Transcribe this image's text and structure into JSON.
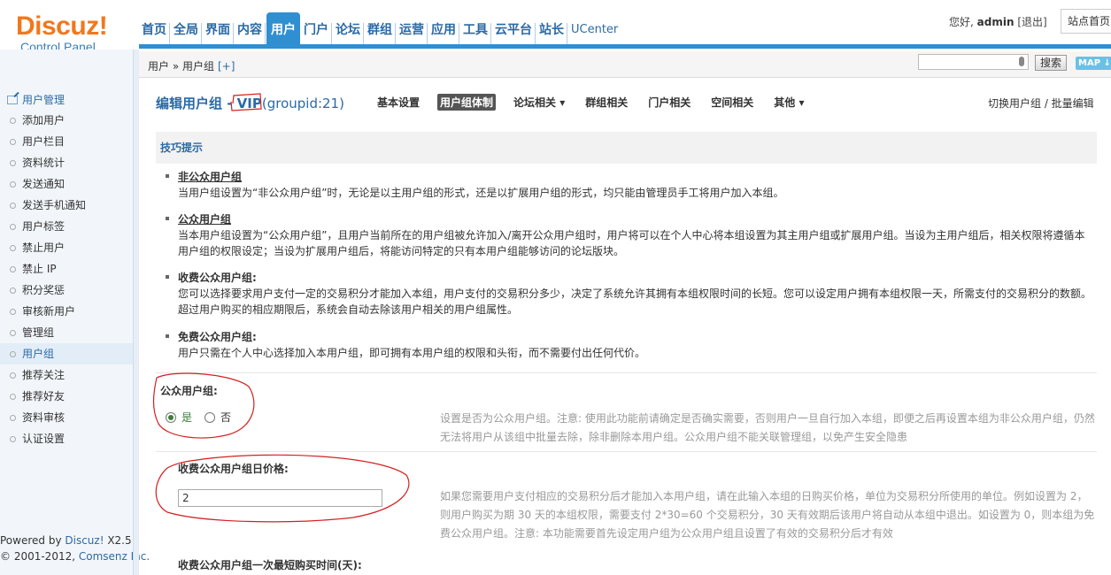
{
  "header": {
    "logo_main": "Discuz!",
    "logo_sub": "Control Panel",
    "nav": [
      "首页",
      "全局",
      "界面",
      "内容",
      "用户",
      "门户",
      "论坛",
      "群组",
      "运营",
      "应用",
      "工具",
      "云平台",
      "站长",
      "UCenter"
    ],
    "nav_active": "用户",
    "greeting": "您好,",
    "username": "admin",
    "logout": "[退出]",
    "site_home": "站点首页"
  },
  "subbar": {
    "breadcrumb": "用户 » 用户组",
    "add": "[+]",
    "search_placeholder": "",
    "search_button": "搜索",
    "map_button": "MAP ↓"
  },
  "sidebar": {
    "title": "用户管理",
    "items": [
      "添加用户",
      "用户栏目",
      "资料统计",
      "发送通知",
      "发送手机通知",
      "用户标签",
      "禁止用户",
      "禁止 IP",
      "积分奖惩",
      "审核新用户",
      "管理组",
      "用户组",
      "推荐关注",
      "推荐好友",
      "资料审核",
      "认证设置"
    ],
    "active": "用户组",
    "powered_prefix": "Powered by ",
    "powered_brand": "Discuz!",
    "powered_version": " X2.5",
    "copyright_prefix": "© 2001-2012, ",
    "copyright_brand": "Comsenz Inc."
  },
  "main": {
    "heading_prefix": "编辑用户组 - ",
    "heading_group": "VIP",
    "heading_gid": "(groupid:21)",
    "tabs": [
      "基本设置",
      "用户组体制",
      "论坛相关 ▾",
      "群组相关",
      "门户相关",
      "空间相关",
      "其他 ▾"
    ],
    "active_tab": "用户组体制",
    "switch_link": "切换用户组 / 批量编辑",
    "tips_title": "技巧提示",
    "tips": [
      {
        "title": "非公众用户组",
        "body": "当用户组设置为“非公众用户组”时，无论是以主用户组的形式，还是以扩展用户组的形式，均只能由管理员手工将用户加入本组。"
      },
      {
        "title": "公众用户组",
        "body": "当本用户组设置为“公众用户组”，且用户当前所在的用户组被允许加入/离开公众用户组时，用户将可以在个人中心将本组设置为其主用户组或扩展用户组。当设为主用户组后，相关权限将遵循本用户组的权限设定；当设为扩展用户组后，将能访问特定的只有本用户组能够访问的论坛版块。"
      },
      {
        "title": "收费公众用户组:",
        "body": "您可以选择要求用户支付一定的交易积分才能加入本组，用户支付的交易积分多少，决定了系统允许其拥有本组权限时间的长短。您可以设定用户拥有本组权限一天，所需支付的交易积分的数额。超过用户购买的相应期限后，系统会自动去除该用户相关的用户组属性。"
      },
      {
        "title": "免费公众用户组:",
        "body": "用户只需在个人中心选择加入本用户组，即可拥有本用户组的权限和头衔，而不需要付出任何代价。"
      }
    ],
    "public_label": "公众用户组:",
    "radio_yes": "是",
    "radio_no": "否",
    "public_tip": "设置是否为公众用户组。注意: 使用此功能前请确定是否确实需要，否则用户一旦自行加入本组，即便之后再设置本组为非公众用户组，仍然无法将用户从该组中批量去除，除非删除本用户组。公众用户组不能关联管理组，以免产生安全隐患",
    "daily_price_label": "收费公众用户组日价格:",
    "daily_price_value": "2",
    "daily_price_tip": "如果您需要用户支付相应的交易积分后才能加入本用户组，请在此输入本组的日购买价格，单位为交易积分所使用的单位。例如设置为 2，则用户购买为期 30 天的本组权限，需要支付 2*30=60 个交易积分，30 天有效期后该用户将自动从本组中退出。如设置为 0，则本组为免费公众用户组。注意: 本功能需要首先设定用户组为公众用户组且设置了有效的交易积分后才有效",
    "min_days_label": "收费公众用户组一次最短购买时间(天):"
  }
}
